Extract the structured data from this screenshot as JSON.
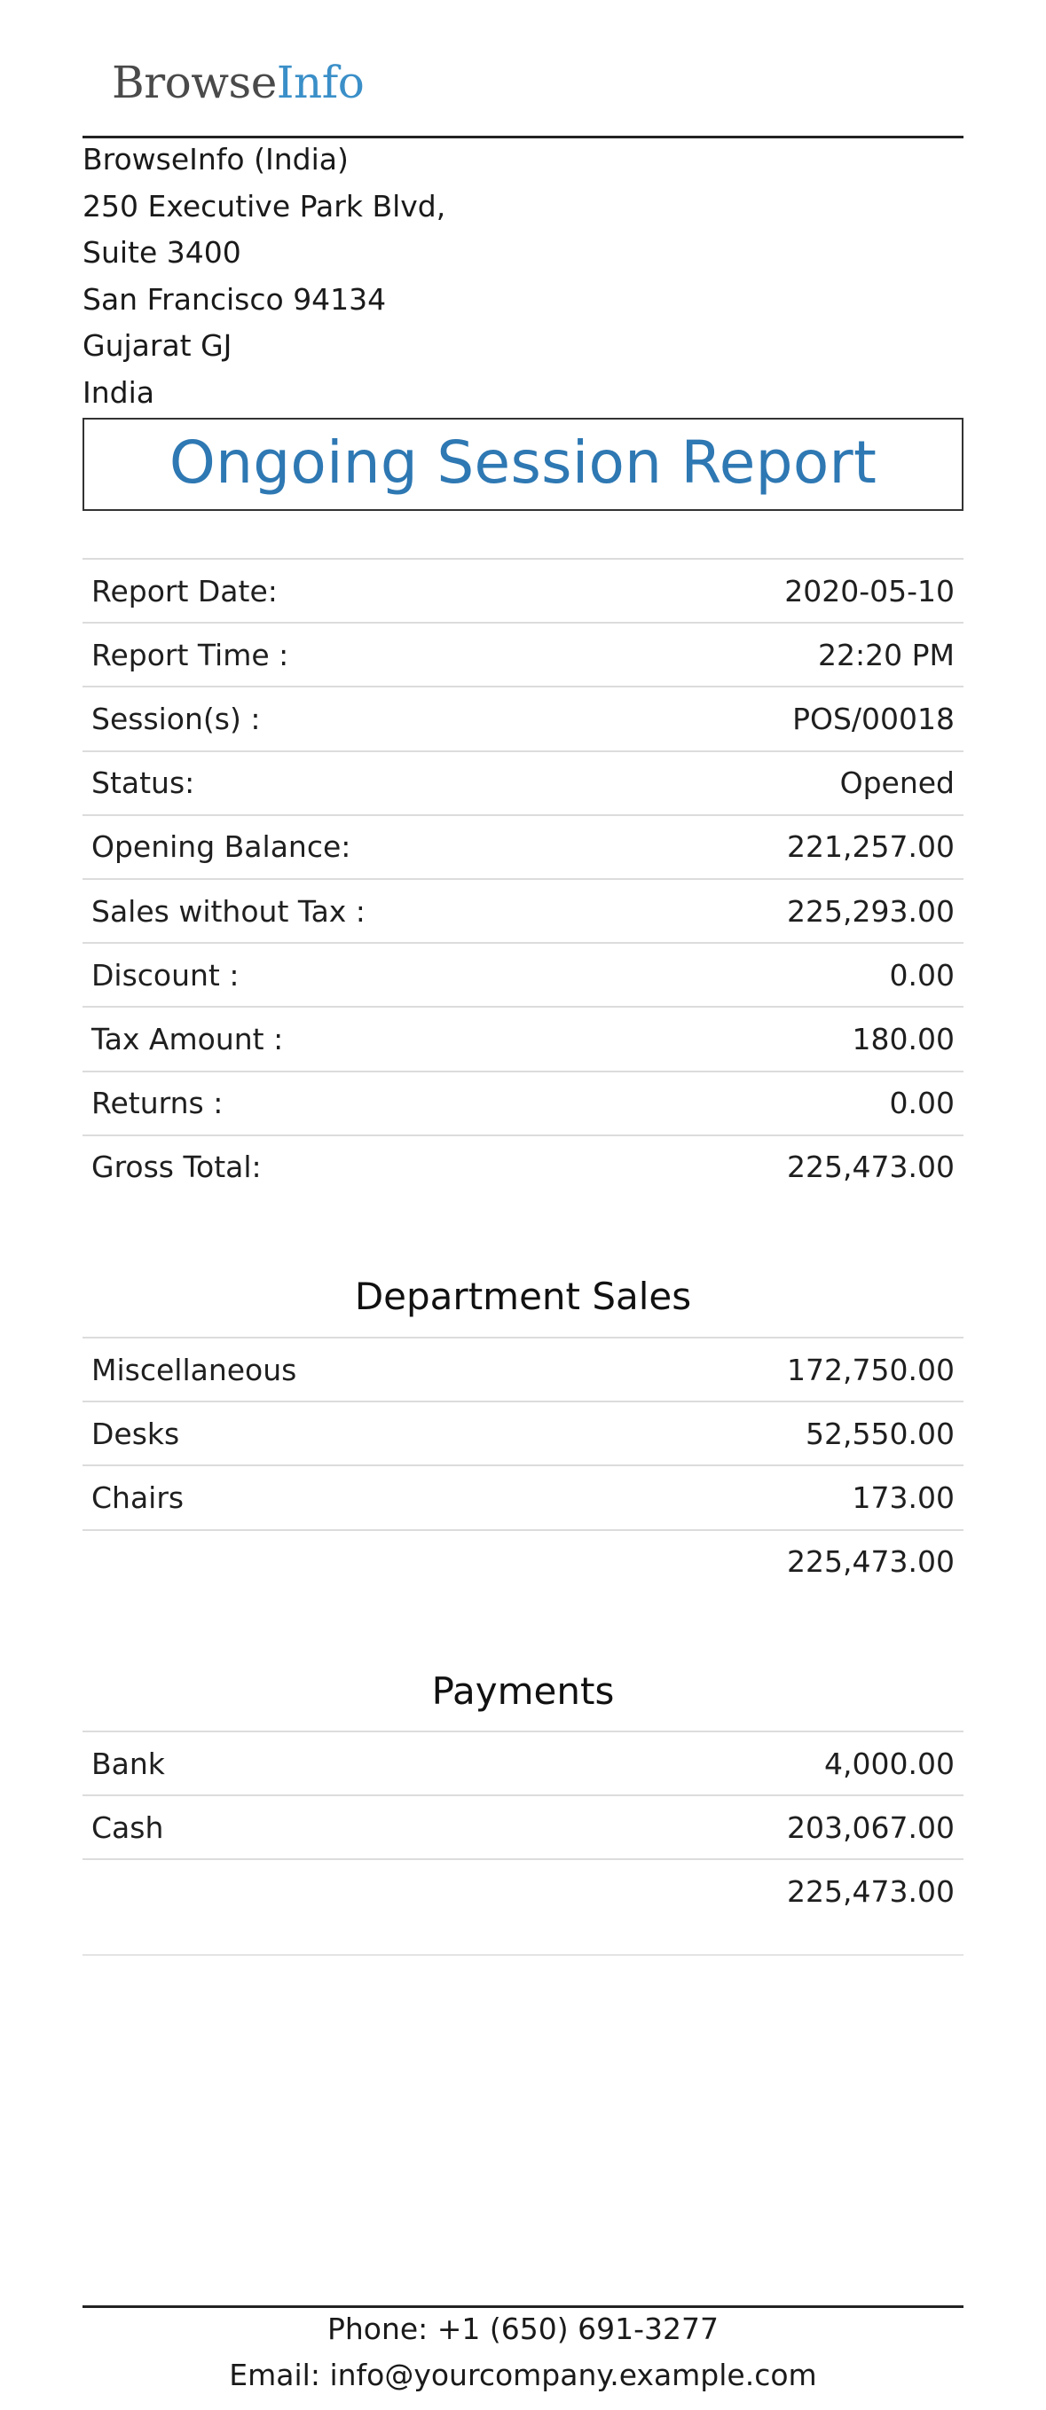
{
  "company": {
    "logo_part1": "Browse",
    "logo_part2": "Info",
    "address_lines": [
      "BrowseInfo (India)",
      "250 Executive Park Blvd,",
      "Suite 3400",
      "San Francisco 94134",
      "Gujarat GJ",
      "India"
    ]
  },
  "report": {
    "title": "Ongoing Session Report",
    "summary": [
      {
        "label": "Report Date:",
        "value": "2020-05-10"
      },
      {
        "label": "Report Time :",
        "value": "22:20 PM"
      },
      {
        "label": "Session(s) :",
        "value": "POS/00018"
      },
      {
        "label": "Status:",
        "value": "Opened"
      },
      {
        "label": "Opening Balance:",
        "value": "221,257.00"
      },
      {
        "label": "Sales without Tax :",
        "value": "225,293.00"
      },
      {
        "label": "Discount :",
        "value": "0.00"
      },
      {
        "label": "Tax Amount :",
        "value": "180.00"
      },
      {
        "label": "Returns :",
        "value": "0.00"
      },
      {
        "label": "Gross Total:",
        "value": "225,473.00"
      }
    ]
  },
  "department_sales": {
    "title": "Department Sales",
    "rows": [
      {
        "label": "Miscellaneous",
        "value": "172,750.00"
      },
      {
        "label": "Desks",
        "value": "52,550.00"
      },
      {
        "label": "Chairs",
        "value": "173.00"
      }
    ],
    "total": "225,473.00"
  },
  "payments": {
    "title": "Payments",
    "rows": [
      {
        "label": "Bank",
        "value": "4,000.00"
      },
      {
        "label": "Cash",
        "value": "203,067.00"
      }
    ],
    "total": "225,473.00"
  },
  "footer": {
    "phone": "Phone: +1 (650) 691-3277",
    "email": "Email: info@yourcompany.example.com"
  }
}
